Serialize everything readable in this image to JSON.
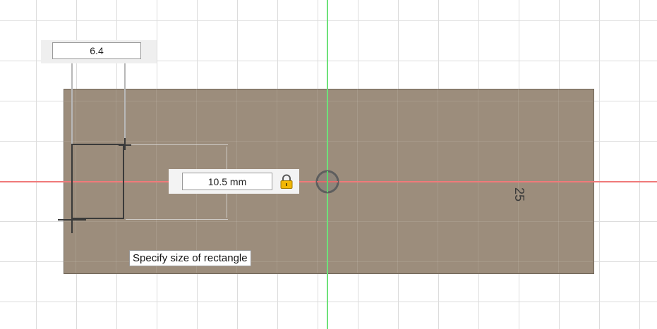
{
  "sketch": {
    "width_value": "6.4",
    "height_value": "10.5 mm",
    "existing_dimension": "25",
    "tooltip": "Specify size of rectangle"
  },
  "colors": {
    "x_axis": "#f07a7a",
    "y_axis": "#6ee27a",
    "body": "#9c8d7c",
    "lock": "#f2b705"
  },
  "icons": {
    "lock": "lock-icon",
    "origin": "origin-point-icon"
  }
}
